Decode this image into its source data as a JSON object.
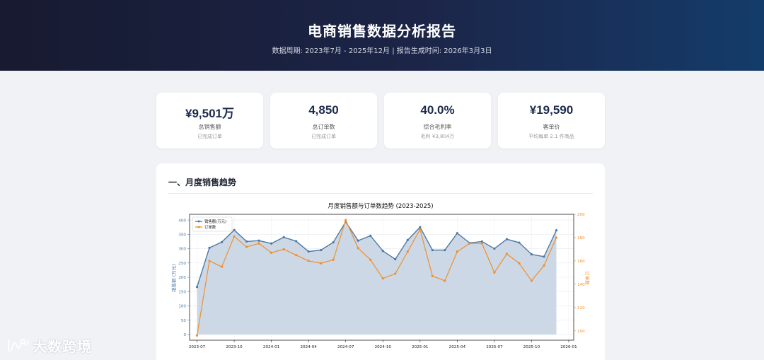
{
  "header": {
    "title": "电商销售数据分析报告",
    "subtitle": "数据周期: 2023年7月 - 2025年12月  |  报告生成时间: 2026年3月3日"
  },
  "kpis": [
    {
      "value": "¥9,501万",
      "label": "总销售额",
      "note": "已完成订单"
    },
    {
      "value": "4,850",
      "label": "总订单数",
      "note": "已完成订单"
    },
    {
      "value": "40.0%",
      "label": "综合毛利率",
      "note": "毛利 ¥3,804万"
    },
    {
      "value": "¥19,590",
      "label": "客单价",
      "note": "平均每单 2.1 件商品"
    }
  ],
  "section": {
    "title": "一、月度销售趋势"
  },
  "watermark": "大数跨境",
  "colors": {
    "sales": "#4f79a3",
    "area": "#c9d6e5",
    "orders": "#f28e2b"
  },
  "chart_data": {
    "type": "line",
    "title": "月度销售额与订单数趋势 (2023-2025)",
    "xlabel": "",
    "x_ticks": [
      "2023-07",
      "2023-10",
      "2024-01",
      "2024-04",
      "2024-07",
      "2024-10",
      "2025-01",
      "2025-04",
      "2025-07",
      "2025-10",
      "2026-01"
    ],
    "x": [
      "2023-07",
      "2023-08",
      "2023-09",
      "2023-10",
      "2023-11",
      "2023-12",
      "2024-01",
      "2024-02",
      "2024-03",
      "2024-04",
      "2024-05",
      "2024-06",
      "2024-07",
      "2024-08",
      "2024-09",
      "2024-10",
      "2024-11",
      "2024-12",
      "2025-01",
      "2025-02",
      "2025-03",
      "2025-04",
      "2025-05",
      "2025-06",
      "2025-07",
      "2025-08",
      "2025-09",
      "2025-10",
      "2025-11",
      "2025-12"
    ],
    "left_axis": {
      "label": "销售额 (万元)",
      "ylim": [
        -20,
        420
      ],
      "ticks": [
        0,
        50,
        100,
        150,
        200,
        250,
        300,
        350,
        400
      ]
    },
    "right_axis": {
      "label": "订单数",
      "ylim": [
        92,
        200
      ],
      "ticks": [
        100,
        120,
        140,
        160,
        180,
        200
      ]
    },
    "grid": true,
    "legend": "top-left",
    "series": [
      {
        "name": "销售额(万元)",
        "axis": "left",
        "area": true,
        "values": [
          166,
          303,
          323,
          365,
          325,
          328,
          318,
          340,
          326,
          290,
          295,
          322,
          394,
          328,
          345,
          292,
          263,
          330,
          375,
          295,
          295,
          354,
          320,
          325,
          300,
          333,
          321,
          280,
          272,
          364
        ]
      },
      {
        "name": "订单数",
        "axis": "right",
        "values": [
          96,
          160,
          155,
          181,
          172,
          175,
          167,
          170,
          165,
          160,
          158,
          161,
          195,
          171,
          161,
          145,
          149,
          168,
          187,
          147,
          143,
          168,
          175,
          175,
          150,
          166,
          158,
          143,
          156,
          180
        ]
      }
    ]
  }
}
